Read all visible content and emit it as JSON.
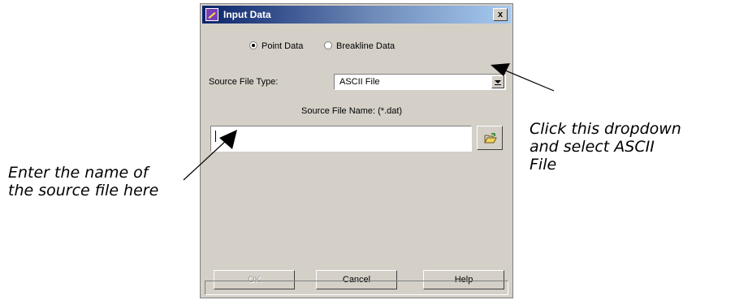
{
  "dialog": {
    "title": "Input Data",
    "close_label": "x",
    "radio_point": "Point Data",
    "radio_breakline": "Breakline Data",
    "radio_selected": "Point Data",
    "source_file_type_label": "Source File Type:",
    "source_file_type_value": "ASCII File",
    "source_file_name_label": "Source File Name: (*.dat)",
    "source_file_name_value": "",
    "ok_label": "OK",
    "cancel_label": "Cancel",
    "help_label": "Help",
    "status_text": ""
  },
  "annotations": {
    "dropdown_line1": "Click this dropdown",
    "dropdown_line2": "and select ASCII",
    "dropdown_line3": "File",
    "file_line1": "Enter the name of",
    "file_line2": "the source file here"
  },
  "colors": {
    "dialog_bg": "#d4d0c8",
    "titlebar_start": "#0a246a",
    "titlebar_end": "#a6caf0"
  },
  "icons": {
    "app": "app-icon",
    "close": "close-icon",
    "dropdown": "chevron-down-icon",
    "browse": "folder-open-icon"
  }
}
